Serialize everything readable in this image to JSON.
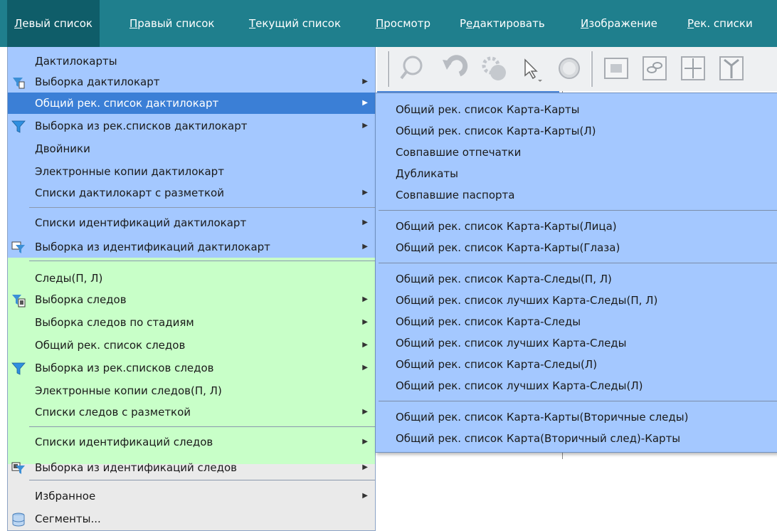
{
  "menubar": {
    "items": [
      {
        "prefix": "",
        "u": "Л",
        "rest": "евый список"
      },
      {
        "prefix": "",
        "u": "П",
        "rest": "равый список"
      },
      {
        "prefix": "",
        "u": "Т",
        "rest": "екущий список"
      },
      {
        "prefix": "",
        "u": "П",
        "rest": "росмотр"
      },
      {
        "prefix": "Р",
        "u": "е",
        "rest": "дактировать"
      },
      {
        "prefix": "",
        "u": "И",
        "rest": "зображение"
      },
      {
        "prefix": "",
        "u": "Р",
        "rest": "ек. списки"
      }
    ]
  },
  "toolbar": {
    "icons": [
      "search-icon",
      "undo-icon",
      "settings-icon",
      "cursor-icon",
      "circle-icon",
      "picture-icon",
      "link-icon",
      "split-icon",
      "branch-icon"
    ]
  },
  "left_menu": {
    "items": [
      {
        "label": "Дактилокарты",
        "submenu": false
      },
      {
        "label": "Выборка дактилокарт",
        "submenu": true,
        "icon": "card-filter-icon"
      },
      {
        "label": "Общий рек. список дактилокарт",
        "submenu": true,
        "highlighted": true
      },
      {
        "label": "Выборка из рек.списков дактилокарт",
        "submenu": true,
        "icon": "filter-icon"
      },
      {
        "label": "Двойники",
        "submenu": false
      },
      {
        "label": "Электронные копии дактилокарт",
        "submenu": false
      },
      {
        "label": "Списки дактилокарт с разметкой",
        "submenu": true
      },
      {
        "label": "Списки идентификаций дактилокарт",
        "submenu": true
      },
      {
        "label": "Выборка из идентификаций дактилокарт",
        "submenu": true,
        "icon": "id-filter-icon"
      },
      {
        "label": "Следы(П, Л)",
        "submenu": false
      },
      {
        "label": "Выборка следов",
        "submenu": true,
        "icon": "trace-filter-icon"
      },
      {
        "label": "Выборка следов по стадиям",
        "submenu": true
      },
      {
        "label": "Общий рек. список следов",
        "submenu": true
      },
      {
        "label": "Выборка из рек.списков следов",
        "submenu": true,
        "icon": "filter-icon"
      },
      {
        "label": "Электронные копии следов(П, Л)",
        "submenu": false
      },
      {
        "label": "Списки следов с разметкой",
        "submenu": true
      },
      {
        "label": "Списки идентификаций следов",
        "submenu": true
      },
      {
        "label": "Выборка из идентификаций следов",
        "submenu": true,
        "icon": "trace-id-filter-icon"
      },
      {
        "label": "Избранное",
        "submenu": true
      },
      {
        "label": "Сегменты...",
        "submenu": false,
        "icon": "database-icon"
      }
    ]
  },
  "sub_menu": {
    "items": [
      "Общий рек. список Карта-Карты",
      "Общий рек. список Карта-Карты(Л)",
      "Совпавшие отпечатки",
      "Дубликаты",
      "Совпавшие паспорта",
      "Общий рек. список Карта-Карты(Лица)",
      "Общий рек. список Карта-Карты(Глаза)",
      "Общий рек. список Карта-Следы(П, Л)",
      "Общий рек. список лучших Карта-Следы(П, Л)",
      "Общий рек. список Карта-Следы",
      "Общий рек. список лучших Карта-Следы",
      "Общий рек. список Карта-Следы(Л)",
      "Общий рек. список лучших Карта-Следы(Л)",
      "Общий рек. список Карта-Карты(Вторичные следы)",
      "Общий рек. список Карта(Вторичный след)-Карты"
    ]
  },
  "colors": {
    "menubar": "#1f7f8d",
    "blue_section": "#a4c8ff",
    "green_section": "#c8ffc8",
    "grey_section": "#eaeaea",
    "highlight": "#3b7fd6"
  }
}
